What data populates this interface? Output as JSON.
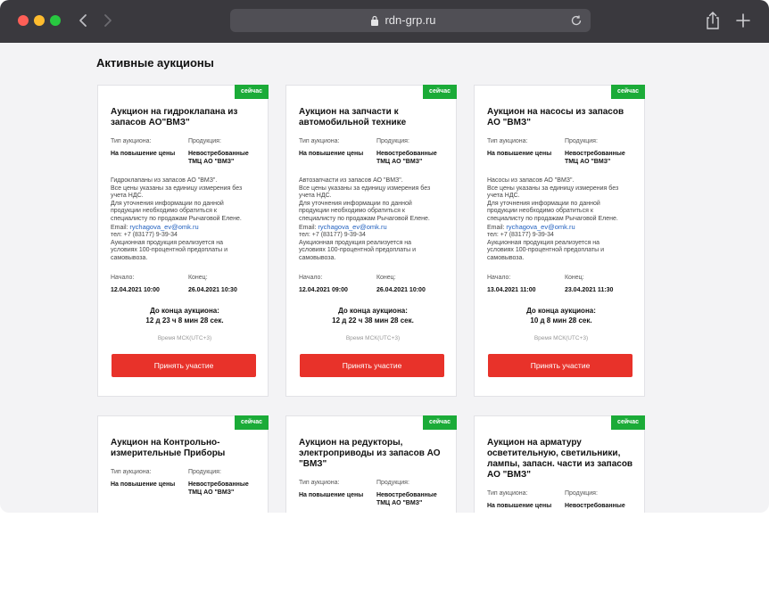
{
  "browser": {
    "url": "rdn-grp.ru"
  },
  "page": {
    "title": "Активные аукционы"
  },
  "labels": {
    "badge": "сейчас",
    "type": "Тип аукциона:",
    "product": "Продукция:",
    "start": "Начало:",
    "end": "Конец:",
    "countdown": "До конца аукциона:",
    "timezone": "Время МСК(UTC+3)",
    "cta": "Принять участие"
  },
  "cards": [
    {
      "title_lines": [
        "Аукцион на гидроклапана из",
        "запасов АО\"ВМЗ\""
      ],
      "type": "На повышение цены",
      "product_lines": [
        "Невостребованные",
        "ТМЦ АО \"ВМЗ\""
      ],
      "desc_lines": [
        "Гидроклапаны из запасов АО \"ВМЗ\".",
        "Все цены указаны за единицу измерения без",
        "учета НДС.",
        "Для уточнения информации по данной",
        "продукции необходимо обратиться к",
        "специалисту по продажам Рычаговой Елене."
      ],
      "email_label": "Email: ",
      "email": "rychagova_ev@omk.ru",
      "tail_lines": [
        "тел: +7 (83177) 9-39-34",
        "Аукционная продукция реализуется на",
        "условиях 100-процентной предоплаты и",
        "самовывоза."
      ],
      "start": "12.04.2021 10:00",
      "end": "26.04.2021 10:30",
      "countdown": "12 д 23 ч 8 мин 28 сек."
    },
    {
      "title_lines": [
        "Аукцион на запчасти к",
        "автомобильной технике"
      ],
      "type": "На повышение цены",
      "product_lines": [
        "Невостребованные",
        "ТМЦ АО \"ВМЗ\""
      ],
      "desc_lines": [
        "Автозапчасти из запасов АО \"ВМЗ\".",
        "Все цены указаны за единицу измерения без",
        "учета НДС.",
        "Для уточнения информации по данной",
        "продукции необходимо обратиться к",
        "специалисту по продажам Рычаговой Елене."
      ],
      "email_label": "Email: ",
      "email": "rychagova_ev@omk.ru",
      "tail_lines": [
        "тел: +7 (83177) 9-39-34",
        "Аукционная продукция реализуется на",
        "условиях 100-процентной предоплаты и",
        "самовывоза."
      ],
      "start": "12.04.2021 09:00",
      "end": "26.04.2021 10:00",
      "countdown": "12 д 22 ч 38 мин 28 сек."
    },
    {
      "title_lines": [
        "Аукцион на насосы из запасов",
        "АО \"ВМЗ\""
      ],
      "type": "На повышение цены",
      "product_lines": [
        "Невостребованные",
        "ТМЦ АО \"ВМЗ\""
      ],
      "desc_lines": [
        "Насосы из запасов АО \"ВМЗ\".",
        "Все цены указаны за единицу измерения без",
        "учета НДС.",
        "Для уточнения информации по данной",
        "продукции необходимо обратиться к",
        "специалисту по продажам Рычаговой Елене."
      ],
      "email_label": "Email: ",
      "email": "rychagova_ev@omk.ru",
      "tail_lines": [
        "тел: +7 (83177) 9-39-34",
        "Аукционная продукция реализуется на",
        "условиях 100-процентной предоплаты и",
        "самовывоза."
      ],
      "start": "13.04.2021 11:00",
      "end": "23.04.2021 11:30",
      "countdown": "10 д 8 мин 28 сек."
    },
    {
      "title_lines": [
        "Аукцион на Контрольно-",
        "измерительные Приборы"
      ],
      "type": "На повышение цены",
      "product_lines": [
        "Невостребованные",
        "ТМЦ АО \"ВМЗ\""
      ]
    },
    {
      "title_lines": [
        "Аукцион на редукторы,",
        "электроприводы из запасов АО",
        "\"ВМЗ\""
      ],
      "type": "На повышение цены",
      "product_lines": [
        "Невостребованные",
        "ТМЦ АО \"ВМЗ\""
      ]
    },
    {
      "title_lines": [
        "Аукцион на арматуру",
        "осветительную, светильники,",
        "лампы, запасн. части из запасов",
        "АО \"ВМЗ\""
      ],
      "type": "На повышение цены",
      "product_lines": [
        "Невостребованные"
      ]
    }
  ]
}
